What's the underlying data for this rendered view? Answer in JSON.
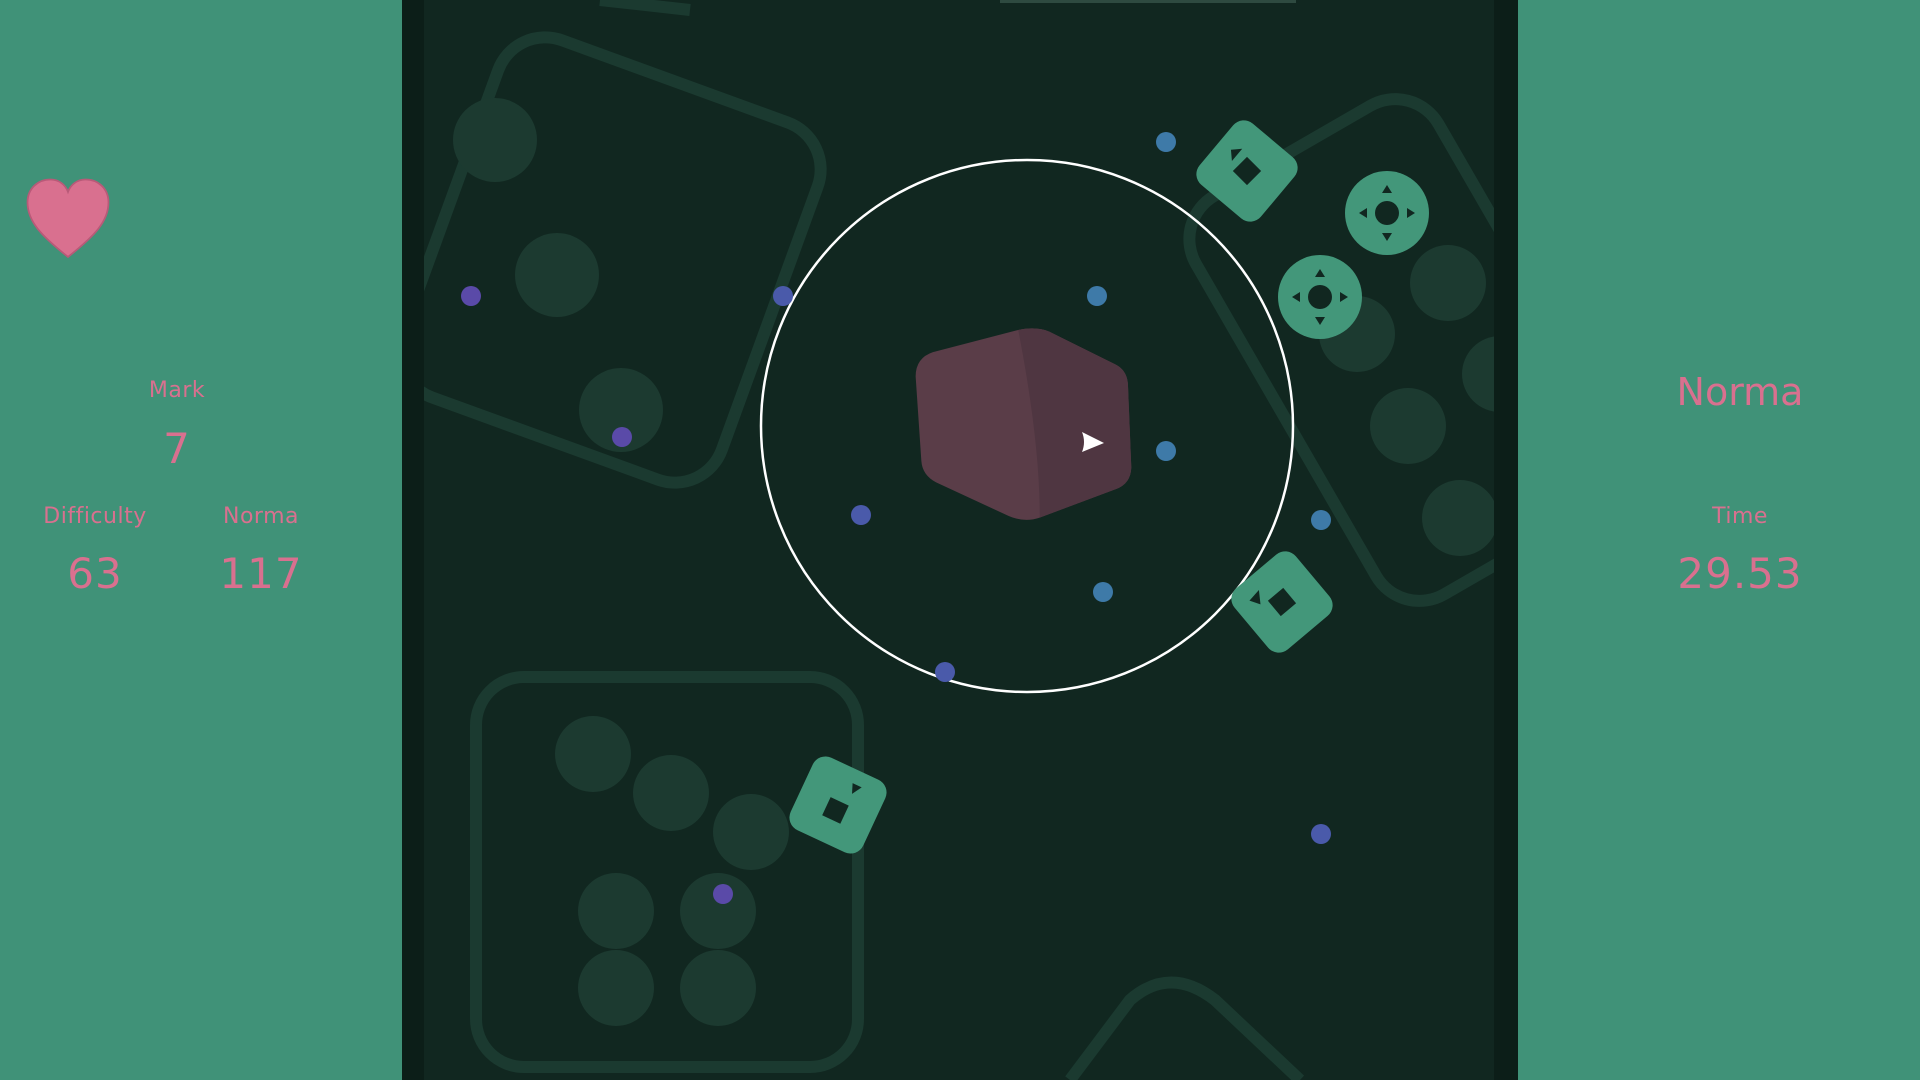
{
  "hud": {
    "lives_icon": "heart-icon",
    "mark_label": "Mark",
    "mark_value": "7",
    "difficulty_label": "Difficulty",
    "difficulty_value": "63",
    "norma_label": "Norma",
    "norma_value": "117",
    "mode_name": "Norma",
    "time_label": "Time",
    "time_value": "29.53"
  },
  "colors": {
    "panel_background": "#409278",
    "field_background": "#112720",
    "hud_text": "#d9708f",
    "heart": "#d9708f",
    "player_cube": "#5a3d48",
    "enemy_dice": "#43977a",
    "blue_dot": "#3e7aa8",
    "purple_dot": "#5a4aa8",
    "range_circle": "#ffffff"
  },
  "icons": {
    "player": "cube-icon",
    "cursor": "play-arrow-icon",
    "enemy_dice": "die-icon",
    "enemy_dpad": "dpad-icon"
  }
}
